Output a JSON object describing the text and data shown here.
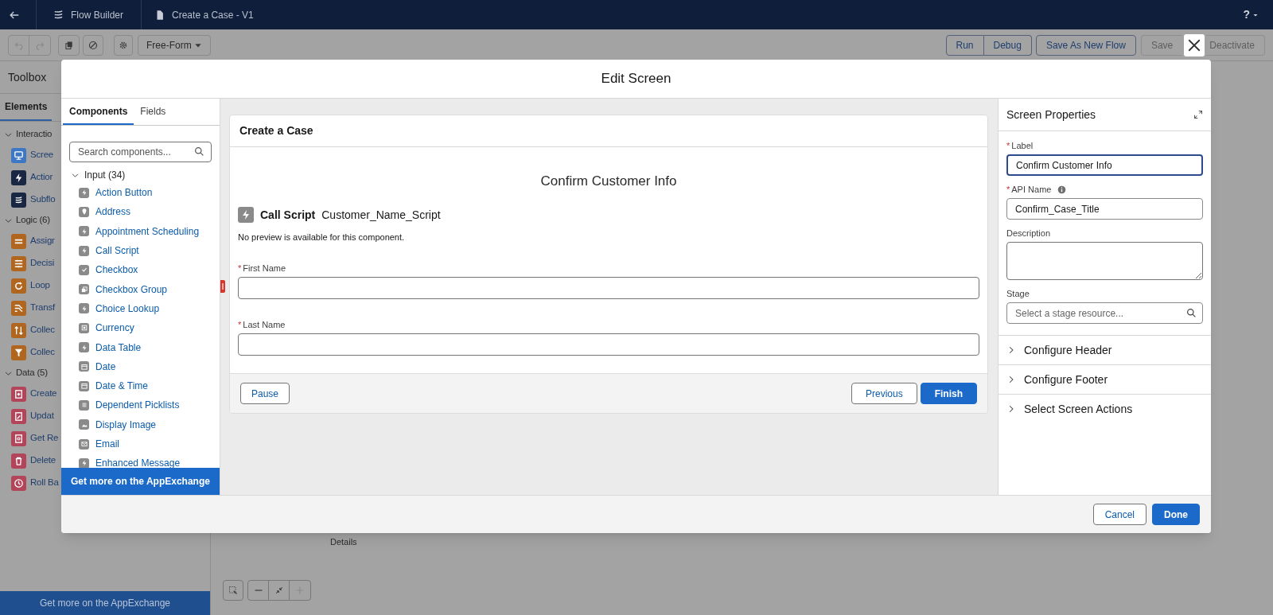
{
  "top_bar": {
    "app_name": "Flow Builder",
    "flow_name": "Create a Case - V1",
    "help": "?"
  },
  "toolbar": {
    "layout": "Free-Form",
    "actions": [
      {
        "label": "Run",
        "disabled": false
      },
      {
        "label": "Debug",
        "disabled": false
      },
      {
        "label": "Save As New Flow",
        "disabled": false
      },
      {
        "label": "Save",
        "disabled": true
      },
      {
        "label": "Deactivate",
        "disabled": true
      }
    ]
  },
  "toolbox": {
    "title": "Toolbox",
    "tabs": [
      {
        "label": "Elements",
        "selected": true
      }
    ],
    "groups": [
      {
        "label": "Interactio",
        "expanded": true,
        "items": [
          {
            "label": "Scree",
            "color": "#3e78c4"
          },
          {
            "label": "Actior",
            "color": "#1a2744"
          },
          {
            "label": "Subflo",
            "color": "#1a2744"
          }
        ]
      },
      {
        "label": "Logic (6)",
        "expanded": true,
        "items": [
          {
            "label": "Assigr",
            "color": "#b0661f"
          },
          {
            "label": "Decisi",
            "color": "#b0661f"
          },
          {
            "label": "Loop",
            "color": "#b0661f"
          },
          {
            "label": "Transf",
            "color": "#b0661f"
          },
          {
            "label": "Collec",
            "color": "#b0661f"
          },
          {
            "label": "Collec",
            "color": "#b0661f"
          }
        ]
      },
      {
        "label": "Data (5)",
        "expanded": true,
        "items": [
          {
            "label": "Create",
            "color": "#b2455a"
          },
          {
            "label": "Updat",
            "color": "#b2455a"
          },
          {
            "label": "Get Re",
            "color": "#b2455a"
          },
          {
            "label": "Delete",
            "color": "#b2455a"
          },
          {
            "label": "Roll Ba",
            "color": "#b2455a"
          }
        ]
      }
    ],
    "appexchange": "Get more on the AppExchange"
  },
  "canvas": {
    "node_label": "Details"
  },
  "modal": {
    "title": "Edit Screen",
    "palette": {
      "tabs": [
        {
          "label": "Components",
          "selected": true
        },
        {
          "label": "Fields",
          "selected": false
        }
      ],
      "search_placeholder": "Search components...",
      "group": {
        "label": "Input (34)",
        "expanded": true,
        "items": [
          "Action Button",
          "Address",
          "Appointment Scheduling",
          "Call Script",
          "Checkbox",
          "Checkbox Group",
          "Choice Lookup",
          "Currency",
          "Data Table",
          "Date",
          "Date & Time",
          "Dependent Picklists",
          "Display Image",
          "Email",
          "Enhanced Message"
        ]
      },
      "appexchange": "Get more on the AppExchange"
    },
    "preview": {
      "card_title": "Create a Case",
      "heading": "Confirm Customer Info",
      "component": {
        "type": "Call Script",
        "name": "Customer_Name_Script",
        "note": "No preview is available for this component."
      },
      "fields": [
        {
          "label": "First Name",
          "required_mark": "*"
        },
        {
          "label": "Last Name",
          "required_mark": "*"
        }
      ],
      "footer_left": [
        {
          "label": "Pause",
          "kind": "neutral"
        }
      ],
      "footer_right": [
        {
          "label": "Previous",
          "kind": "neutral"
        },
        {
          "label": "Finish",
          "kind": "brand"
        }
      ]
    },
    "properties": {
      "title": "Screen Properties",
      "fields": [
        {
          "kind": "input",
          "label": "Label",
          "required_mark": "*",
          "value": "Confirm Customer Info",
          "focused": true
        },
        {
          "kind": "input",
          "label": "API Name",
          "required_mark": "*",
          "info": true,
          "value": "Confirm_Case_Title",
          "focused": false
        },
        {
          "kind": "textarea",
          "label": "Description"
        },
        {
          "kind": "search",
          "label": "Stage",
          "placeholder": "Select a stage resource..."
        }
      ],
      "sections": [
        {
          "label": "Configure Header",
          "expanded": false
        },
        {
          "label": "Configure Footer",
          "expanded": false
        },
        {
          "label": "Select Screen Actions",
          "expanded": false
        }
      ]
    },
    "buttons": [
      {
        "label": "Cancel",
        "kind": "neutral"
      },
      {
        "label": "Done",
        "kind": "brand"
      }
    ]
  }
}
